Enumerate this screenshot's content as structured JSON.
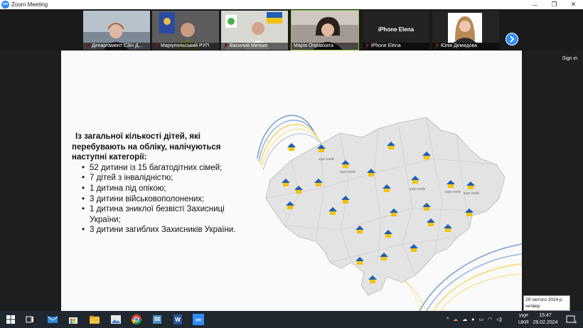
{
  "window": {
    "title": "Zoom Meeting",
    "logo": "zm"
  },
  "participants": [
    {
      "name": "Департамент СЗН Д..."
    },
    {
      "name": "Маріупольський РУП"
    },
    {
      "name": "Василий Митько"
    },
    {
      "name": "Марія Оправхата"
    },
    {
      "name": "iPhone Elena",
      "center_label": "iPhone Elena"
    },
    {
      "name": "Юлія Демидова"
    }
  ],
  "stage": {
    "sign_in": "Sign in"
  },
  "slide": {
    "heading": "Із загальної кількості дітей, які перебувають на обліку, налічуються наступні категорії:",
    "items": [
      "52 дитини із 15 багатодітних сімей;",
      "7 дітей з інвалідністю;",
      "1 дитина під опікою;",
      "3 дитини військовополонених;",
      "1 дитина зниклої безвісті Захисниці України;",
      "3 дитини загиблих Захисників України."
    ],
    "map_marker_label": "тут тебе"
  },
  "tooltip": {
    "line1": "29 лютого 2024 р.",
    "line2": "четвер"
  },
  "taskbar": {
    "lang_top": "УКР",
    "lang_bottom": "UKR",
    "time": "15:47",
    "date": "29.02.2024",
    "notifications": "4"
  },
  "colors": {
    "accent": "#2d8cff",
    "map_fill": "#e3e3e3",
    "flag_blue": "#1f5fb5",
    "flag_yellow": "#f2c200"
  }
}
